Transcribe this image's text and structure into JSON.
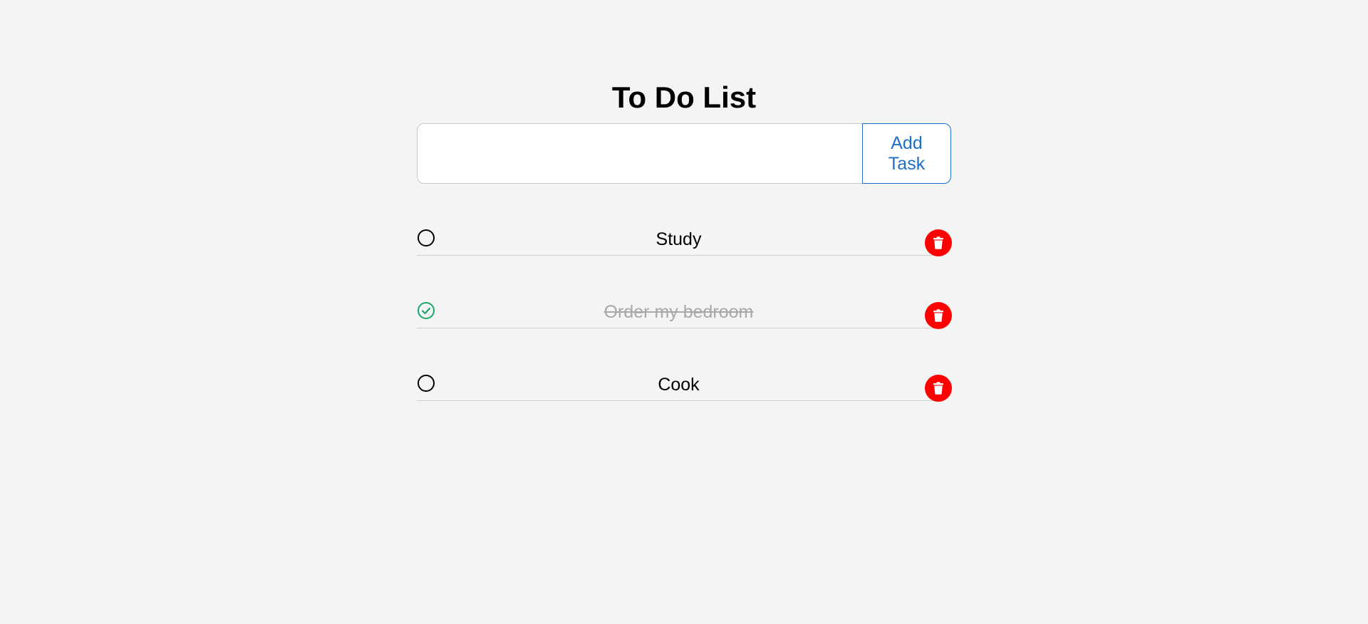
{
  "app": {
    "title": "To Do List"
  },
  "input": {
    "value": "",
    "placeholder": ""
  },
  "add_button": {
    "label_line1": "Add",
    "label_line2": "Task"
  },
  "tasks": [
    {
      "label": "Study",
      "completed": false
    },
    {
      "label": "Order my bedroom",
      "completed": true
    },
    {
      "label": "Cook",
      "completed": false
    }
  ],
  "colors": {
    "background": "#f4f4f4",
    "accent_blue": "#1e6fc9",
    "delete_red": "#ff0000",
    "check_green": "#1aa86a",
    "done_text": "#a8a8a8"
  },
  "icons": {
    "pending": "circle-outline-icon",
    "done": "circle-check-icon",
    "delete": "trash-icon"
  }
}
